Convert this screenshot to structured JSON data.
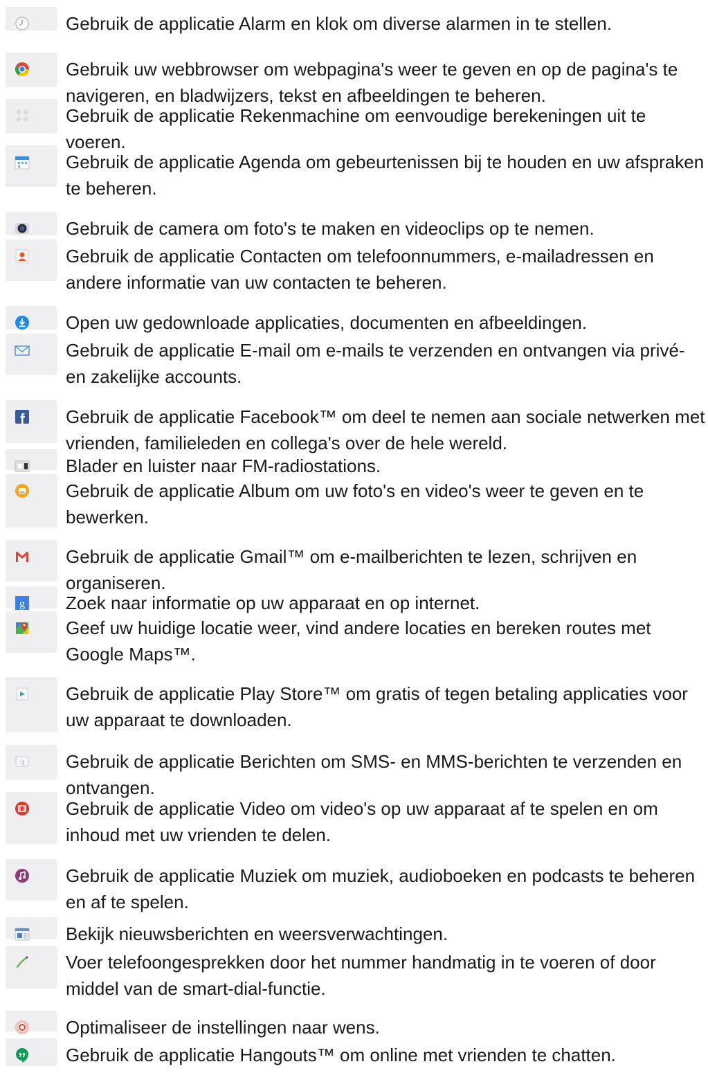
{
  "items": [
    {
      "icon": "alarm-clock-icon",
      "text": "Gebruik de applicatie Alarm en klok om diverse alarmen in te stellen."
    },
    {
      "icon": "chrome-browser-icon",
      "text": "Gebruik uw webbrowser om webpagina's weer te geven en op de pagina's te navigeren, en bladwijzers, tekst en afbeeldingen te beheren."
    },
    {
      "icon": "calculator-icon",
      "text": "Gebruik de applicatie Rekenmachine om eenvoudige berekeningen uit te voeren."
    },
    {
      "icon": "calendar-icon",
      "text": "Gebruik de applicatie Agenda om gebeurtenissen bij te houden en uw afspraken te beheren."
    },
    {
      "icon": "camera-icon",
      "text": "Gebruik de camera om foto's te maken en videoclips op te nemen."
    },
    {
      "icon": "contacts-icon",
      "text": "Gebruik de applicatie Contacten om telefoonnummers, e-mailadressen en andere informatie van uw contacten te beheren."
    },
    {
      "icon": "download-icon",
      "text": "Open uw gedownloade applicaties, documenten en afbeeldingen."
    },
    {
      "icon": "email-envelope-icon",
      "text": "Gebruik de applicatie E-mail om e-mails te verzenden en ontvangen via privé- en zakelijke accounts."
    },
    {
      "icon": "facebook-icon",
      "text": "Gebruik de applicatie Facebook™ om deel te nemen aan sociale netwerken met vrienden, familieleden en collega's over de hele wereld."
    },
    {
      "icon": "fm-radio-icon",
      "text": "Blader en luister naar FM-radiostations."
    },
    {
      "icon": "album-icon",
      "text": "Gebruik de applicatie Album om uw foto's en video's weer te geven en te bewerken."
    },
    {
      "icon": "gmail-icon",
      "text": "Gebruik de applicatie Gmail™ om e-mailberichten te lezen, schrijven en organiseren."
    },
    {
      "icon": "google-search-icon",
      "text": "Zoek naar informatie op uw apparaat en op internet."
    },
    {
      "icon": "google-maps-icon",
      "text": "Geef uw huidige locatie weer, vind andere locaties en bereken routes met Google Maps™."
    },
    {
      "icon": "play-store-icon",
      "text": "Gebruik de applicatie Play Store™ om gratis of tegen betaling applicaties voor uw apparaat te downloaden."
    },
    {
      "icon": "messaging-icon",
      "text": "Gebruik de applicatie Berichten om SMS- en MMS-berichten te verzenden en ontvangen."
    },
    {
      "icon": "video-icon",
      "text": "Gebruik de applicatie Video om video's op uw apparaat af te spelen en om inhoud met uw vrienden te delen."
    },
    {
      "icon": "music-icon",
      "text": "Gebruik de applicatie Muziek om muziek, audioboeken en podcasts te beheren en af te spelen."
    },
    {
      "icon": "news-weather-icon",
      "text": "Bekijk nieuwsberichten en weersverwachtingen."
    },
    {
      "icon": "phone-icon",
      "text": "Voer telefoongesprekken door het nummer handmatig in te voeren of door middel van de smart-dial-functie."
    },
    {
      "icon": "settings-icon",
      "text": "Optimaliseer de instellingen naar wens."
    },
    {
      "icon": "hangouts-icon",
      "text": "Gebruik de applicatie Hangouts™ om online met vrienden te chatten."
    }
  ]
}
